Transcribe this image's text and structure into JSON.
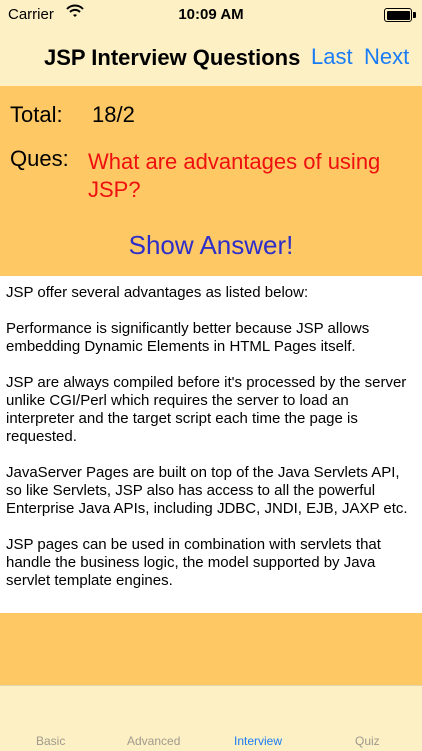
{
  "status_bar": {
    "carrier": "Carrier",
    "time": "10:09 AM",
    "icons": [
      "wifi-icon",
      "battery-icon"
    ]
  },
  "nav": {
    "title": "JSP Interview Questions",
    "last_label": "Last",
    "next_label": "Next",
    "accent_color": "#1a7cf4"
  },
  "question": {
    "total_label": "Total:",
    "total_value": "18/2",
    "ques_label": "Ques:",
    "ques_text": "What are advantages of using JSP?",
    "show_answer_label": "Show Answer!",
    "panel_color": "#fec965",
    "question_color": "#ee0f0f"
  },
  "answer": {
    "paragraphs": [
      "JSP offer several advantages as listed below:",
      "Performance is significantly better because JSP allows embedding Dynamic Elements in HTML Pages itself.",
      "JSP are always compiled before it's processed by the server unlike CGI/Perl which requires the server to load an interpreter and the target script each time the page is requested.",
      "JavaServer Pages are built on top of the Java Servlets API, so like Servlets, JSP also has access to all the powerful Enterprise Java APIs, including JDBC, JNDI, EJB, JAXP etc.",
      "JSP pages can be used in combination with servlets that handle the business logic, the model supported by Java servlet template engines."
    ]
  },
  "tabs": [
    {
      "label": "Basic",
      "active": false
    },
    {
      "label": "Advanced",
      "active": false
    },
    {
      "label": "Interview",
      "active": true
    },
    {
      "label": "Quiz",
      "active": false
    }
  ]
}
